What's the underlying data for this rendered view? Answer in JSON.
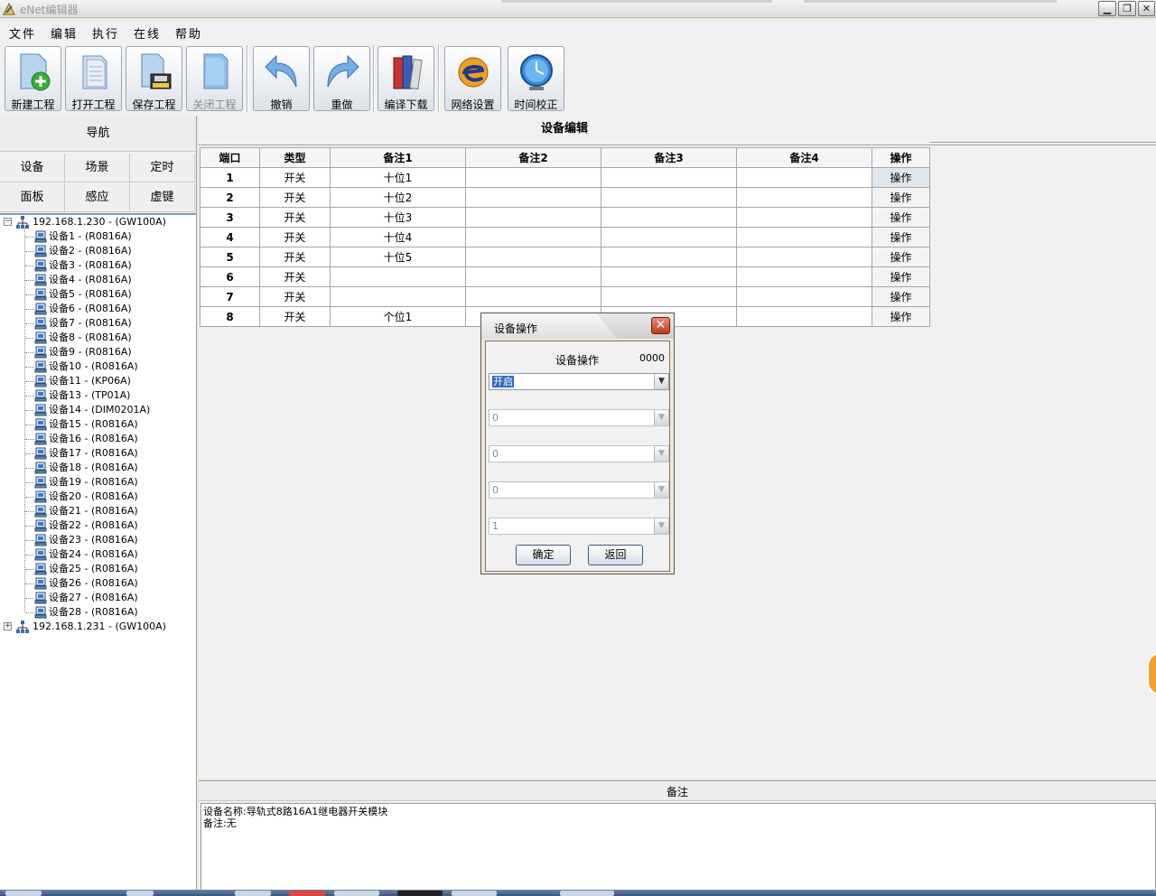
{
  "window": {
    "title": "eNet编辑器"
  },
  "menu": [
    "文件",
    "编辑",
    "执行",
    "在线",
    "帮助"
  ],
  "toolbar": {
    "new_project": "新建工程",
    "open_project": "打开工程",
    "save_project": "保存工程",
    "close_project": "关闭工程",
    "undo": "撤销",
    "redo": "重做",
    "compile_download": "编译下载",
    "network_settings": "网络设置",
    "time_calibration": "时间校正"
  },
  "nav": {
    "header": "导航",
    "buttons": [
      "设备",
      "场景",
      "定时",
      "面板",
      "感应",
      "虚键"
    ]
  },
  "tree": {
    "gateways": [
      {
        "label": "192.168.1.230 - (GW100A)"
      },
      {
        "label": "192.168.1.231 - (GW100A)"
      }
    ],
    "devices": [
      "设备1 - (R0816A)",
      "设备2 - (R0816A)",
      "设备3 - (R0816A)",
      "设备4 - (R0816A)",
      "设备5 - (R0816A)",
      "设备6 - (R0816A)",
      "设备7 - (R0816A)",
      "设备8 - (R0816A)",
      "设备9 - (R0816A)",
      "设备10 - (R0816A)",
      "设备11 - (KP06A)",
      "设备13 - (TP01A)",
      "设备14 - (DIM0201A)",
      "设备15 - (R0816A)",
      "设备16 - (R0816A)",
      "设备17 - (R0816A)",
      "设备18 - (R0816A)",
      "设备19 - (R0816A)",
      "设备20 - (R0816A)",
      "设备21 - (R0816A)",
      "设备22 - (R0816A)",
      "设备23 - (R0816A)",
      "设备24 - (R0816A)",
      "设备25 - (R0816A)",
      "设备26 - (R0816A)",
      "设备27 - (R0816A)",
      "设备28 - (R0816A)"
    ]
  },
  "main": {
    "title": "设备编辑",
    "columns": [
      "端口",
      "类型",
      "备注1",
      "备注2",
      "备注3",
      "备注4",
      "操作"
    ],
    "rows": [
      {
        "port": "1",
        "type": "开关",
        "note1": "十位1",
        "note2": "",
        "note3": "",
        "note4": "",
        "op": "操作"
      },
      {
        "port": "2",
        "type": "开关",
        "note1": "十位2",
        "note2": "",
        "note3": "",
        "note4": "",
        "op": "操作"
      },
      {
        "port": "3",
        "type": "开关",
        "note1": "十位3",
        "note2": "",
        "note3": "",
        "note4": "",
        "op": "操作"
      },
      {
        "port": "4",
        "type": "开关",
        "note1": "十位4",
        "note2": "",
        "note3": "",
        "note4": "",
        "op": "操作"
      },
      {
        "port": "5",
        "type": "开关",
        "note1": "十位5",
        "note2": "",
        "note3": "",
        "note4": "",
        "op": "操作"
      },
      {
        "port": "6",
        "type": "开关",
        "note1": "",
        "note2": "",
        "note3": "",
        "note4": "",
        "op": "操作"
      },
      {
        "port": "7",
        "type": "开关",
        "note1": "",
        "note2": "",
        "note3": "",
        "note4": "",
        "op": "操作"
      },
      {
        "port": "8",
        "type": "开关",
        "note1": "个位1",
        "note2": "",
        "note3": "",
        "note4": "",
        "op": "操作"
      }
    ]
  },
  "notes": {
    "header": "备注",
    "device_name": "设备名称:导轨式8路16A1继电器开关模块",
    "remark": "备注:无"
  },
  "dialog": {
    "title": "设备操作",
    "op_label": "设备操作",
    "op_code": "0000",
    "combos": [
      "开启",
      "0",
      "0",
      "0",
      "1"
    ],
    "ok": "确定",
    "back": "返回"
  },
  "colors": {
    "selection": "#316ac5",
    "close_button": "#c2381c",
    "accent_orange": "#f0a030"
  }
}
